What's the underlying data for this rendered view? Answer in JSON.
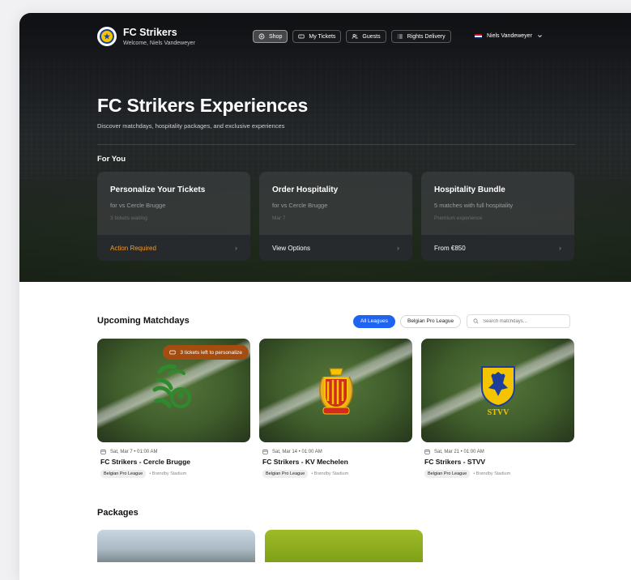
{
  "header": {
    "brand_name": "FC Strikers",
    "welcome": "Welcome, Niels Vandeweyer",
    "nav": [
      {
        "label": "Shop",
        "icon": "shop-icon",
        "active": true
      },
      {
        "label": "My Tickets",
        "icon": "ticket-icon",
        "active": false
      },
      {
        "label": "Guests",
        "icon": "guests-icon",
        "active": false
      },
      {
        "label": "Rights Delivery",
        "icon": "list-icon",
        "active": false
      }
    ],
    "user_name": "Niels Vandeweyer",
    "user_flag": "uk-flag-icon"
  },
  "hero": {
    "title": "FC Strikers Experiences",
    "subtitle": "Discover matchdays, hospitality packages, and exclusive experiences",
    "for_you_label": "For You"
  },
  "for_you": [
    {
      "title": "Personalize Your Tickets",
      "subtitle": "for vs Cercle Brugge",
      "detail": "3 tickets waiting",
      "action": "Action Required",
      "action_color": "#f29a2e"
    },
    {
      "title": "Order Hospitality",
      "subtitle": "for vs Cercle Brugge",
      "detail": "Mar 7",
      "action": "View Options",
      "action_color": "#ffffff"
    },
    {
      "title": "Hospitality Bundle",
      "subtitle": "5 matches with full hospitality",
      "detail": "Premium experience",
      "action": "From €850",
      "action_color": "#ffffff"
    }
  ],
  "upcoming": {
    "title": "Upcoming Matchdays",
    "filters": [
      {
        "label": "All Leagues",
        "active": true
      },
      {
        "label": "Belgian Pro League",
        "active": false
      }
    ],
    "search_placeholder": "Search matchdays...",
    "matches": [
      {
        "date": "Sat, Mar 7 • 01:00 AM",
        "name": "FC Strikers - Cercle Brugge",
        "league": "Belgian Pro League",
        "venue": "• Brøndby Stadium",
        "badge": "3 tickets left to personalize",
        "crest": "cercle-brugge-crest-icon"
      },
      {
        "date": "Sat, Mar 14 • 01:00 AM",
        "name": "FC Strikers - KV Mechelen",
        "league": "Belgian Pro League",
        "venue": "• Brøndby Stadium",
        "badge": "",
        "crest": "kv-mechelen-crest-icon"
      },
      {
        "date": "Sat, Mar 21 • 01:00 AM",
        "name": "FC Strikers - STVV",
        "league": "Belgian Pro League",
        "venue": "• Brøndby Stadium",
        "badge": "",
        "crest": "stvv-crest-icon"
      }
    ]
  },
  "packages": {
    "title": "Packages"
  },
  "colors": {
    "accent": "#1e64f0",
    "warning": "#f29a2e",
    "badge_bg": "#a54d11"
  }
}
